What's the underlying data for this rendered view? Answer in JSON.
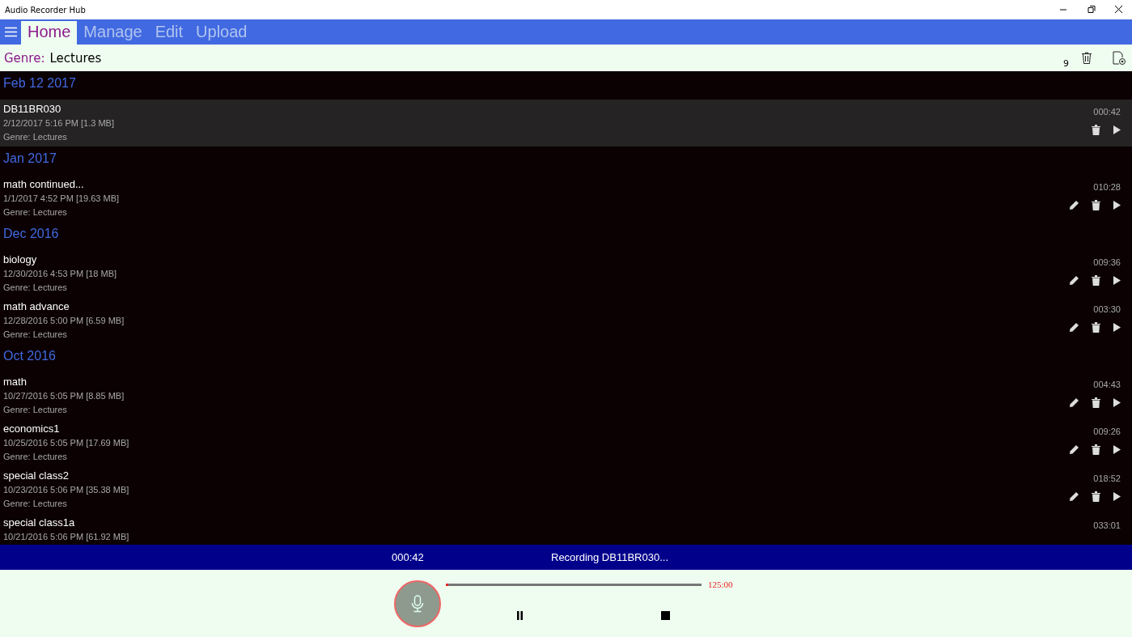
{
  "window": {
    "title": "Audio Recorder Hub"
  },
  "tabs": [
    {
      "label": "Home",
      "selected": true
    },
    {
      "label": "Manage",
      "selected": false
    },
    {
      "label": "Edit",
      "selected": false
    },
    {
      "label": "Upload",
      "selected": false
    }
  ],
  "genre_bar": {
    "label": "Genre:",
    "value": "Lectures",
    "count": "9"
  },
  "groups": [
    {
      "header": "Feb 12 2017",
      "items": [
        {
          "name": "DB11BR030",
          "details": "2/12/2017 5:16 PM [1.3 MB]",
          "genre": "Genre: Lectures",
          "duration": "000:42",
          "selected": true,
          "editable": false
        }
      ]
    },
    {
      "header": "Jan 2017",
      "items": [
        {
          "name": "math continued...",
          "details": "1/1/2017 4:52 PM [19.63 MB]",
          "genre": "Genre: Lectures",
          "duration": "010:28",
          "selected": false,
          "editable": true
        }
      ]
    },
    {
      "header": "Dec 2016",
      "items": [
        {
          "name": "biology",
          "details": "12/30/2016 4:53 PM [18 MB]",
          "genre": "Genre: Lectures",
          "duration": "009:36",
          "selected": false,
          "editable": true
        },
        {
          "name": "math advance",
          "details": "12/28/2016 5:00 PM [6.59 MB]",
          "genre": "Genre: Lectures",
          "duration": "003:30",
          "selected": false,
          "editable": true
        }
      ]
    },
    {
      "header": "Oct 2016",
      "items": [
        {
          "name": "math",
          "details": "10/27/2016 5:05 PM [8.85 MB]",
          "genre": "Genre: Lectures",
          "duration": "004:43",
          "selected": false,
          "editable": true
        },
        {
          "name": "economics1",
          "details": "10/25/2016 5:05 PM [17.69 MB]",
          "genre": "Genre: Lectures",
          "duration": "009:26",
          "selected": false,
          "editable": true
        },
        {
          "name": "special class2",
          "details": "10/23/2016 5:06 PM [35.38 MB]",
          "genre": "Genre: Lectures",
          "duration": "018:52",
          "selected": false,
          "editable": true
        },
        {
          "name": "special class1a",
          "details": "10/21/2016 5:06 PM [61.92 MB]",
          "duration": "033:01",
          "selected": false
        }
      ]
    }
  ],
  "status_bar": {
    "elapsed": "000:42",
    "message": "Recording DB11BR030..."
  },
  "recorder": {
    "level": 0.01,
    "total": "125:00"
  }
}
